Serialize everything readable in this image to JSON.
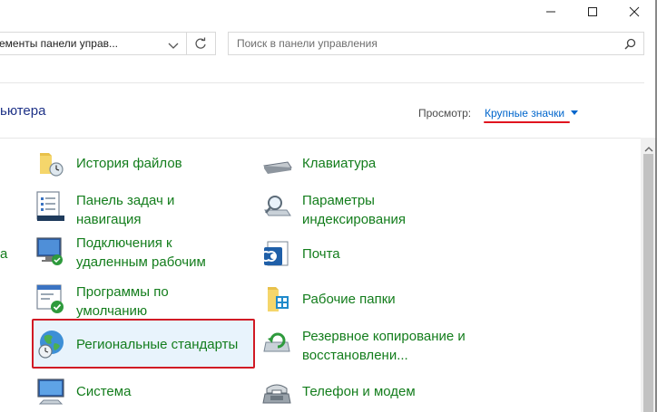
{
  "window": {
    "minimize_icon": "minimize-icon",
    "maximize_icon": "maximize-icon",
    "close_icon": "close-icon"
  },
  "address_bar": {
    "path": "ементы панели управ...",
    "dropdown_icon": "chevron-down-icon",
    "refresh_icon": "refresh-icon"
  },
  "search": {
    "placeholder": "Поиск в панели управления",
    "icon": "search-icon"
  },
  "header": {
    "section_title": "ьютера",
    "view_label": "Просмотр:",
    "view_value": "Крупные значки",
    "accent": "#0066cc",
    "annotation_color": "#e0141e"
  },
  "left_cut_text": "а",
  "items_left": [
    {
      "label": "История файлов",
      "icon": "file-history-icon"
    },
    {
      "label_line1": "Панель задач и",
      "label_line2": "навигация",
      "icon": "taskbar-icon"
    },
    {
      "label_line1": "Подключения к",
      "label_line2": "удаленным рабочим",
      "icon": "remote-desktop-icon"
    },
    {
      "label_line1": "Программы по",
      "label_line2": "умолчанию",
      "icon": "default-programs-icon"
    },
    {
      "label": "Региональные стандарты",
      "icon": "region-icon"
    },
    {
      "label": "Система",
      "icon": "system-icon"
    }
  ],
  "items_right": [
    {
      "label": "Клавиатура",
      "icon": "keyboard-icon"
    },
    {
      "label_line1": "Параметры",
      "label_line2": "индексирования",
      "icon": "indexing-icon"
    },
    {
      "label": "Почта",
      "icon": "mail-icon"
    },
    {
      "label": "Рабочие папки",
      "icon": "work-folders-icon"
    },
    {
      "label_line1": "Резервное копирование и",
      "label_line2": "восстановлени...",
      "icon": "backup-icon"
    },
    {
      "label": "Телефон и модем",
      "icon": "phone-modem-icon"
    }
  ],
  "colors": {
    "item_text": "#137d1c",
    "highlight_border": "#d11a25"
  }
}
